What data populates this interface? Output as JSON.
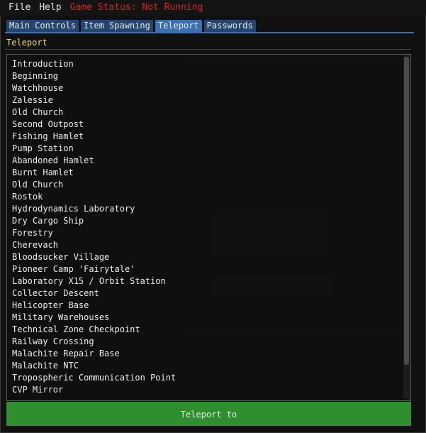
{
  "menu": {
    "file": "File",
    "help": "Help",
    "status": "Game Status: Not Running"
  },
  "tabs": [
    {
      "label": "Main Controls",
      "active": false
    },
    {
      "label": "Item Spawning",
      "active": false
    },
    {
      "label": "Teleport",
      "active": true
    },
    {
      "label": "Passwords",
      "active": false
    }
  ],
  "section": {
    "title": "Teleport"
  },
  "locations": [
    "Introduction",
    "Beginning",
    "Watchhouse",
    "Zalessie",
    "Old Church",
    "Second Outpost",
    "Fishing Hamlet",
    "Pump Station",
    "Abandoned Hamlet",
    "Burnt Hamlet",
    "Old Church",
    "Rostok",
    "Hydrodynamics Laboratory",
    "Dry Cargo Ship",
    "Forestry",
    "Cherevach",
    "Bloodsucker Village",
    "Pioneer Camp 'Fairytale'",
    "Laboratory X15 / Orbit Station",
    "Collector Descent",
    "Helicopter Base",
    "Military Warehouses",
    "Technical Zone Checkpoint",
    "Railway Crossing",
    "Malachite Repair Base",
    "Malachite NTC",
    "Tropospheric Communication Point",
    "CVP Mirror"
  ],
  "teleport_button": {
    "label": "Teleport to"
  },
  "colors": {
    "accent": "#3a6fb0",
    "status": "#e02020",
    "section_title": "#f0e060",
    "button": "#2f8f2f"
  }
}
